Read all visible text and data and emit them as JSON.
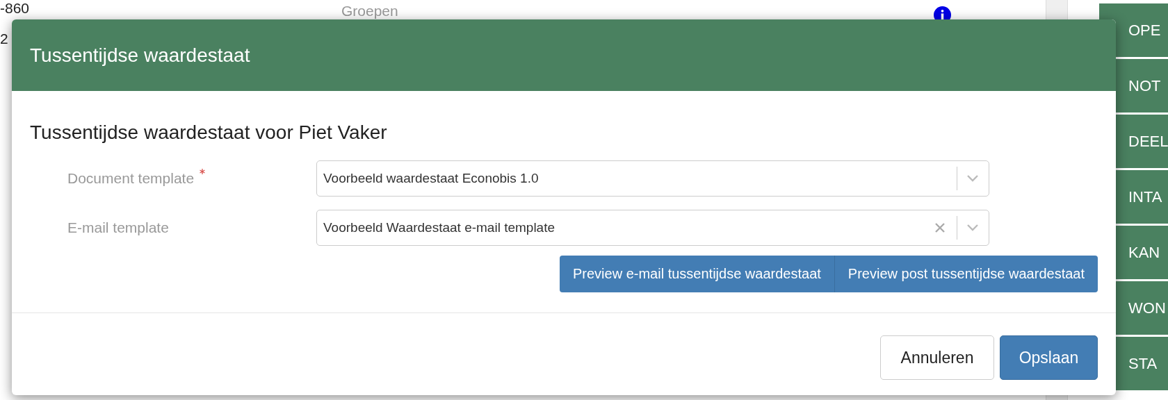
{
  "background": {
    "number": "-860",
    "number_2": "2",
    "section_label": "Groepen"
  },
  "side_tabs": [
    {
      "label": "OPE"
    },
    {
      "label": "NOT"
    },
    {
      "label": "DEEL"
    },
    {
      "label": "INTA"
    },
    {
      "label": "KAN"
    },
    {
      "label": "WON"
    },
    {
      "label": "STA"
    }
  ],
  "modal": {
    "title": "Tussentijdse waardestaat",
    "heading": "Tussentijdse waardestaat voor Piet Vaker",
    "fields": [
      {
        "label": "Document template",
        "required": true,
        "value": "Voorbeeld waardestaat Econobis 1.0",
        "clearable": false
      },
      {
        "label": "E-mail template",
        "required": false,
        "value": "Voorbeeld Waardestaat e-mail template",
        "clearable": true
      }
    ],
    "preview_buttons": [
      "Preview e-mail tussentijdse waardestaat",
      "Preview post tussentijdse waardestaat"
    ],
    "footer_buttons": [
      {
        "label": "Annuleren",
        "kind": "default"
      },
      {
        "label": "Opslaan",
        "kind": "primary"
      }
    ]
  }
}
